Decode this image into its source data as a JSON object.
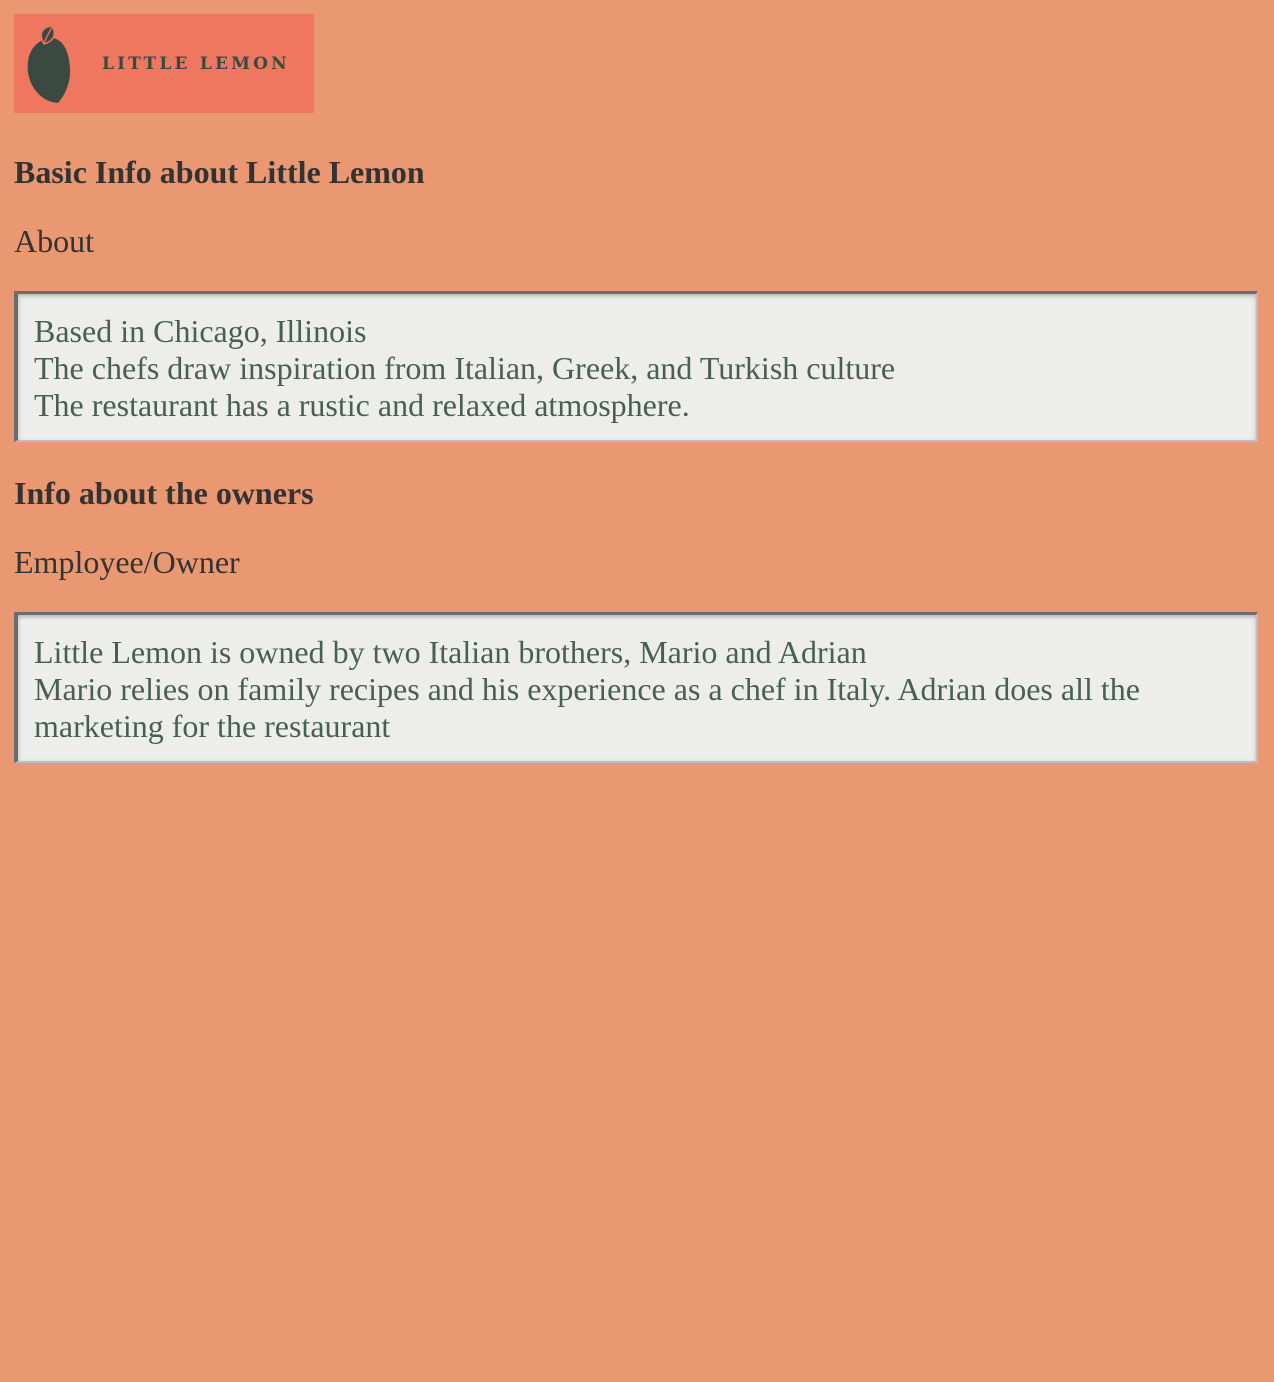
{
  "logo": {
    "text": "LITTLE LEMON",
    "background_color": "#EF775F",
    "icon": "lemon-icon",
    "icon_color": "#3B4A40"
  },
  "page": {
    "background_color": "#EA9872"
  },
  "section_basic": {
    "heading": "Basic Info about Little Lemon",
    "label": "About",
    "lines": [
      "Based in Chicago, Illinois",
      "The chefs draw inspiration from Italian, Greek, and Turkish culture",
      "The restaurant has a rustic and relaxed atmosphere."
    ]
  },
  "section_owners": {
    "heading": "Info about the owners",
    "label": "Employee/Owner",
    "lines": [
      "Little Lemon is owned by two Italian brothers, Mario and Adrian",
      "Mario relies on family recipes and his experience as a chef in Italy. Adrian does all the marketing for the restaurant"
    ]
  }
}
